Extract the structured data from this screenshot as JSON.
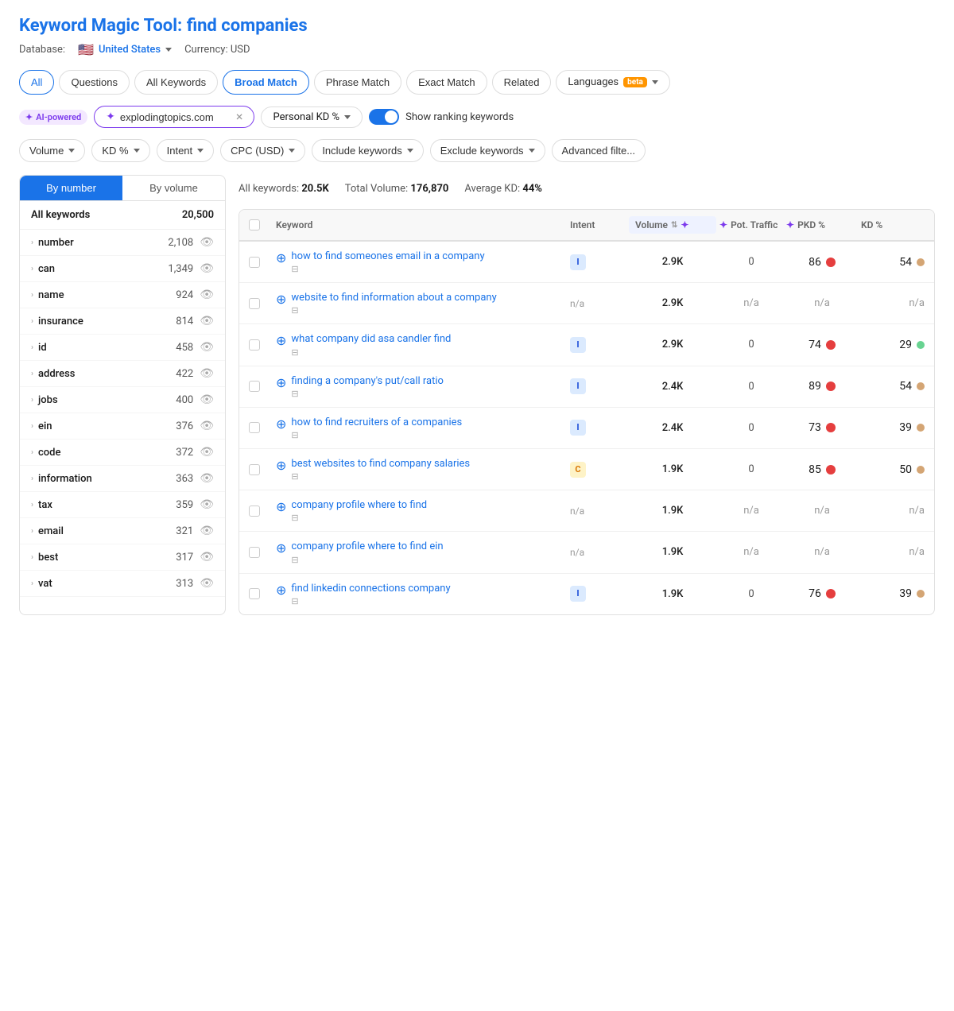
{
  "page": {
    "title_static": "Keyword Magic Tool:",
    "title_query": "find companies",
    "db_label": "Database:",
    "db_value": "United States",
    "currency_label": "Currency: USD"
  },
  "tabs": [
    {
      "id": "all",
      "label": "All",
      "active": false
    },
    {
      "id": "questions",
      "label": "Questions",
      "active": false
    },
    {
      "id": "all-keywords",
      "label": "All Keywords",
      "active": false
    },
    {
      "id": "broad-match",
      "label": "Broad Match",
      "active": true
    },
    {
      "id": "phrase-match",
      "label": "Phrase Match",
      "active": false
    },
    {
      "id": "exact-match",
      "label": "Exact Match",
      "active": false
    },
    {
      "id": "related",
      "label": "Related",
      "active": false
    }
  ],
  "languages_tab": {
    "label": "Languages",
    "badge": "beta"
  },
  "filter_bar": {
    "ai_label": "AI-powered",
    "domain_value": "explodingtopics.com",
    "kd_label": "Personal KD %",
    "toggle_label": "Show ranking keywords"
  },
  "filters": [
    {
      "id": "volume",
      "label": "Volume"
    },
    {
      "id": "kd",
      "label": "KD %"
    },
    {
      "id": "intent",
      "label": "Intent"
    },
    {
      "id": "cpc",
      "label": "CPC (USD)"
    },
    {
      "id": "include",
      "label": "Include keywords"
    },
    {
      "id": "exclude",
      "label": "Exclude keywords"
    },
    {
      "id": "advanced",
      "label": "Advanced filte..."
    }
  ],
  "sidebar": {
    "tabs": [
      {
        "id": "by-number",
        "label": "By number",
        "active": true
      },
      {
        "id": "by-volume",
        "label": "By volume",
        "active": false
      }
    ],
    "all_row": {
      "label": "All keywords",
      "count": "20,500"
    },
    "items": [
      {
        "word": "number",
        "count": "2,108"
      },
      {
        "word": "can",
        "count": "1,349"
      },
      {
        "word": "name",
        "count": "924"
      },
      {
        "word": "insurance",
        "count": "814"
      },
      {
        "word": "id",
        "count": "458"
      },
      {
        "word": "address",
        "count": "422"
      },
      {
        "word": "jobs",
        "count": "400"
      },
      {
        "word": "ein",
        "count": "376"
      },
      {
        "word": "code",
        "count": "372"
      },
      {
        "word": "information",
        "count": "363"
      },
      {
        "word": "tax",
        "count": "359"
      },
      {
        "word": "email",
        "count": "321"
      },
      {
        "word": "best",
        "count": "317"
      },
      {
        "word": "vat",
        "count": "313"
      }
    ]
  },
  "results": {
    "all_keywords_label": "All keywords:",
    "all_keywords_value": "20.5K",
    "total_volume_label": "Total Volume:",
    "total_volume_value": "176,870",
    "avg_kd_label": "Average KD:",
    "avg_kd_value": "44%"
  },
  "table": {
    "headers": [
      {
        "id": "checkbox",
        "label": ""
      },
      {
        "id": "keyword",
        "label": "Keyword"
      },
      {
        "id": "intent",
        "label": "Intent"
      },
      {
        "id": "volume",
        "label": "Volume"
      },
      {
        "id": "pot-traffic",
        "label": "Pot. Traffic"
      },
      {
        "id": "pkd",
        "label": "PKD %"
      },
      {
        "id": "kd",
        "label": "KD %"
      }
    ],
    "rows": [
      {
        "keyword": "how to find someones email in a company",
        "intent": "I",
        "intent_type": "i",
        "volume": "2.9K",
        "traffic": "0",
        "pkd": "86",
        "pkd_dot": "red",
        "kd": "54",
        "kd_dot": "tan"
      },
      {
        "keyword": "website to find information about a company",
        "intent": "n/a",
        "intent_type": "na",
        "volume": "2.9K",
        "traffic": "n/a",
        "pkd": "n/a",
        "pkd_dot": "gray",
        "kd": "n/a",
        "kd_dot": "none"
      },
      {
        "keyword": "what company did asa candler find",
        "intent": "I",
        "intent_type": "i",
        "volume": "2.9K",
        "traffic": "0",
        "pkd": "74",
        "pkd_dot": "red",
        "kd": "29",
        "kd_dot": "mint"
      },
      {
        "keyword": "finding a company's put/call ratio",
        "intent": "I",
        "intent_type": "i",
        "volume": "2.4K",
        "traffic": "0",
        "pkd": "89",
        "pkd_dot": "red",
        "kd": "54",
        "kd_dot": "tan"
      },
      {
        "keyword": "how to find recruiters of a companies",
        "intent": "I",
        "intent_type": "i",
        "volume": "2.4K",
        "traffic": "0",
        "pkd": "73",
        "pkd_dot": "red",
        "kd": "39",
        "kd_dot": "tan"
      },
      {
        "keyword": "best websites to find company salaries",
        "intent": "C",
        "intent_type": "c",
        "volume": "1.9K",
        "traffic": "0",
        "pkd": "85",
        "pkd_dot": "red",
        "kd": "50",
        "kd_dot": "tan"
      },
      {
        "keyword": "company profile where to find",
        "intent": "n/a",
        "intent_type": "na",
        "volume": "1.9K",
        "traffic": "n/a",
        "pkd": "n/a",
        "pkd_dot": "gray",
        "kd": "n/a",
        "kd_dot": "none"
      },
      {
        "keyword": "company profile where to find ein",
        "intent": "n/a",
        "intent_type": "na",
        "volume": "1.9K",
        "traffic": "n/a",
        "pkd": "n/a",
        "pkd_dot": "gray",
        "kd": "n/a",
        "kd_dot": "none"
      },
      {
        "keyword": "find linkedin connections company",
        "intent": "I",
        "intent_type": "i",
        "volume": "1.9K",
        "traffic": "0",
        "pkd": "76",
        "pkd_dot": "red",
        "kd": "39",
        "kd_dot": "tan"
      }
    ]
  }
}
